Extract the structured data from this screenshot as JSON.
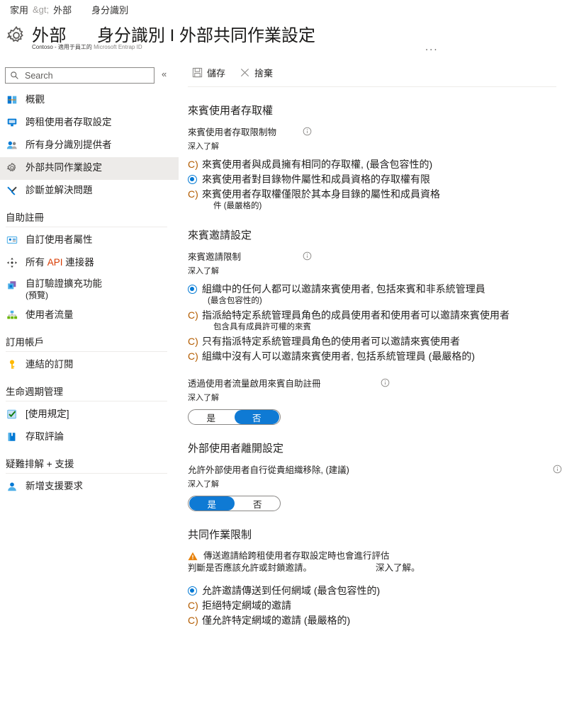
{
  "breadcrumb": {
    "home": "家用",
    "sep": "&gt;",
    "level2": "外部",
    "level3": "身分識別"
  },
  "header": {
    "icon": "gear-icon",
    "title": "外部",
    "title2": "身分識別 I 外部共同作業設定",
    "subtitle_main": "Contoso - 適用于員工的",
    "subtitle_light": "Microsoft Entrap ID",
    "more": "..."
  },
  "sidebar": {
    "search_placeholder": "Search",
    "collapse": "«",
    "items": [
      {
        "label": "概觀",
        "icon": "overview-icon"
      },
      {
        "label": "跨租使用者存取設定",
        "icon": "monitor-icon"
      },
      {
        "label": "所有身分識別提供者",
        "icon": "users-icon"
      },
      {
        "label": "外部共同作業設定",
        "icon": "gear-icon",
        "selected": true
      },
      {
        "label": "診斷並解決問題",
        "icon": "wrench-icon"
      }
    ],
    "groups": [
      {
        "title": "自助註冊",
        "items": [
          {
            "label": "自訂使用者屬性",
            "icon": "id-card-icon"
          },
          {
            "label": "所有 API 連接器",
            "icon": "connector-icon",
            "highlight": "API"
          },
          {
            "label": "自訂驗證擴充功能",
            "sub": "(預覽)",
            "icon": "extension-icon"
          },
          {
            "label": "使用者流量",
            "icon": "flow-icon"
          }
        ]
      },
      {
        "title": "訂用帳戶",
        "items": [
          {
            "label": "連結的訂閱",
            "icon": "key-icon"
          }
        ]
      },
      {
        "title": "生命週期管理",
        "items": [
          {
            "label": "[使用規定]",
            "icon": "checkbox-icon"
          },
          {
            "label": "存取評論",
            "icon": "book-icon"
          }
        ]
      },
      {
        "title": "疑難排解 + 支援",
        "items": [
          {
            "label": "新增支援要求",
            "icon": "support-person-icon"
          }
        ]
      }
    ]
  },
  "toolbar": {
    "save_label": "儲存",
    "save_icon": "save-icon",
    "discard_label": "捨棄",
    "discard_icon": "close-x-icon"
  },
  "sections": [
    {
      "title": "來賓使用者存取權",
      "field_label": "來賓使用者存取限制物",
      "learn_more": "深入了解",
      "options": [
        {
          "text": "來賓使用者與成員擁有相同的存取權,",
          "suffix": "(最含包容性的)",
          "selected": false
        },
        {
          "text": "來賓使用者對目錄物件屬性和成員資格的存取權有限",
          "selected": true
        },
        {
          "text": "來賓使用者存取權僅限於其本身目錄的屬性和成員資格",
          "sub": "件 (最嚴格的)",
          "selected": false
        }
      ]
    },
    {
      "title": "來賓邀請設定",
      "field_label": "來賓邀請限制",
      "learn_more": "深入了解",
      "options": [
        {
          "text": "組織中的任何人都可以邀請來賓使用者, 包括來賓和非系統管理員",
          "sub": "(最含包容性的)",
          "selected": true
        },
        {
          "text": "指派給特定系統管理員角色的成員使用者和使用者可以邀請來賓使用者",
          "sub": "包含具有成員許可權的來賓",
          "selected": false
        },
        {
          "text": "只有指派特定系統管理員角色的使用者可以邀請來賓使用者",
          "selected": false
        },
        {
          "text": "組織中沒有人可以邀請來賓使用者, 包括系統管理員 (最嚴格的)",
          "selected": false
        }
      ],
      "toggle_field": {
        "label": "透過使用者流量啟用來賓自助註冊",
        "learn_more": "深入了解",
        "yes": "是",
        "no": "否",
        "selected": "否"
      }
    },
    {
      "title": "外部使用者離開設定",
      "field_label": "允許外部使用者自行從貴組織移除, (建議)",
      "learn_more": "深入了解",
      "toggle_field": {
        "yes": "是",
        "no": "否",
        "selected": "是"
      }
    },
    {
      "title": "共同作業限制",
      "warning_icon": "warning-triangle-icon",
      "warning_line1": "傳送邀請給跨租使用者存取設定時也會進行評估",
      "warning_line2": "判斷是否應該允許或封鎖邀請。",
      "warning_link": "深入了解。",
      "options": [
        {
          "text": "允許邀請傳送到任何網域 (最含包容性的)",
          "selected": true
        },
        {
          "text": "拒絕特定網域的邀請",
          "selected": false
        },
        {
          "text": "僅允許特定網域的邀請 (最嚴格的)",
          "selected": false
        }
      ]
    }
  ],
  "colors": {
    "accent": "#0078d4",
    "toggle_on": "#0f7ad4",
    "warning": "#e8820c",
    "radio_unselected": "#b35c00"
  }
}
